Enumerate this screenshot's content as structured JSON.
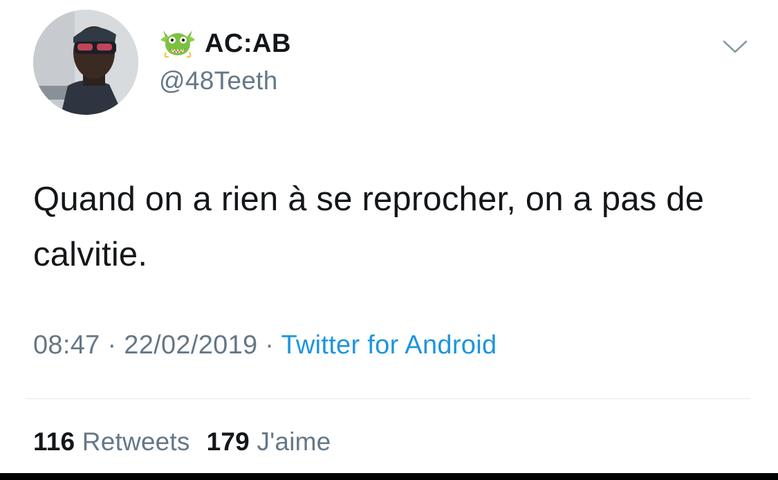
{
  "user": {
    "display_name": "AC:AB",
    "handle": "@48Teeth",
    "name_emoji": "dragon-face-emoji"
  },
  "tweet": {
    "text": "Quand on a rien à se reprocher, on a pas de calvitie.",
    "time": "08:47",
    "separator": " · ",
    "date": "22/02/2019",
    "source": "Twitter for Android"
  },
  "stats": {
    "retweets_count": "116",
    "retweets_label": "Retweets",
    "likes_count": "179",
    "likes_label": "J'aime"
  },
  "icons": {
    "menu": "chevron-down-icon"
  },
  "colors": {
    "text": "#14171a",
    "secondary": "#657786",
    "link": "#1b95e0",
    "divider": "#e1e8ed"
  }
}
